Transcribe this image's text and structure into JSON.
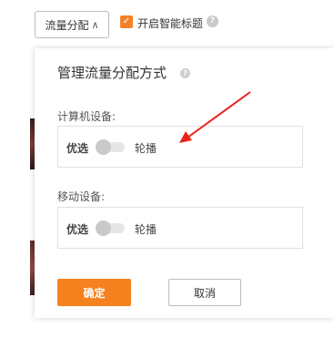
{
  "topbar": {
    "distribution_button": "流量分配",
    "distribution_chevron": "∧",
    "smart_title_checked": true,
    "smart_title_label": "开启智能标题",
    "help_glyph": "?"
  },
  "popover": {
    "title": "管理流量分配方式",
    "help_glyph": "?",
    "computer_section": {
      "label": "计算机设备:",
      "option_left": "优选",
      "option_right": "轮播",
      "toggle_on": false
    },
    "mobile_section": {
      "label": "移动设备:",
      "option_left": "优选",
      "option_right": "轮播",
      "toggle_on": false
    },
    "confirm_label": "确定",
    "cancel_label": "取消"
  },
  "colors": {
    "accent": "#f5811f",
    "annotation": "#e8231b"
  }
}
